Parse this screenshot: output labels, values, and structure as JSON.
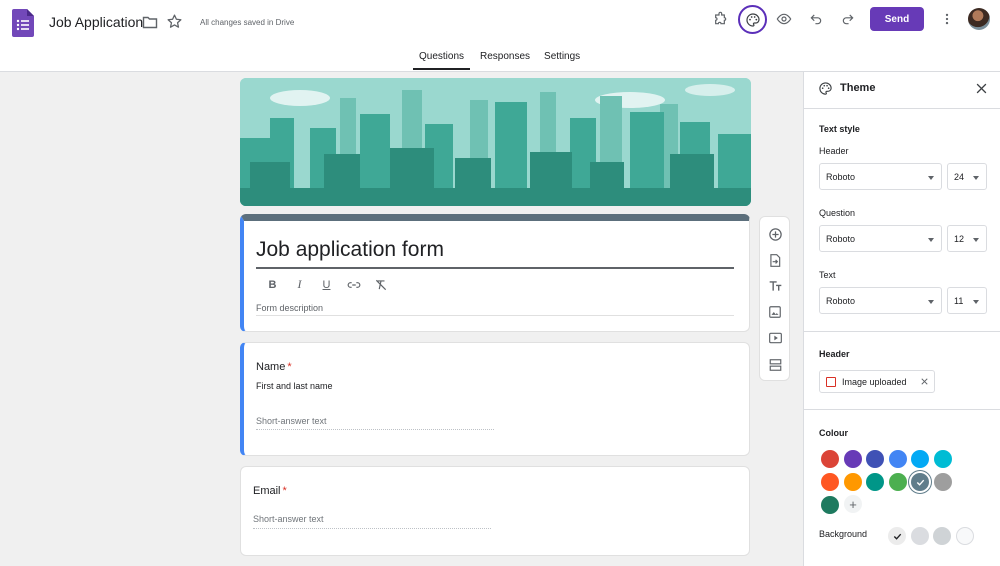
{
  "header": {
    "doc_title": "Job Application",
    "saved_status": "All changes saved in Drive",
    "send_label": "Send",
    "icons": [
      "forms-logo-icon",
      "folder-icon",
      "star-icon",
      "addons-icon",
      "palette-icon",
      "preview-icon",
      "undo-icon",
      "redo-icon",
      "more-icon"
    ]
  },
  "tabs": [
    {
      "label": "Questions",
      "active": true
    },
    {
      "label": "Responses",
      "active": false
    },
    {
      "label": "Settings",
      "active": false
    }
  ],
  "form": {
    "title": "Job application form",
    "description_placeholder": "Form description",
    "format_buttons": [
      "B",
      "I",
      "U"
    ]
  },
  "questions": [
    {
      "label": "Name",
      "required_mark": "*",
      "description": "First and last name",
      "placeholder": "Short-answer text"
    },
    {
      "label": "Email",
      "required_mark": "*",
      "placeholder": "Short-answer text"
    }
  ],
  "theme_panel": {
    "title": "Theme",
    "text_style_title": "Text style",
    "header_label": "Header",
    "header_font": "Roboto",
    "header_size": "24",
    "question_label": "Question",
    "question_font": "Roboto",
    "question_size": "12",
    "text_label": "Text",
    "text_font": "Roboto",
    "text_size": "11",
    "header_section_title": "Header",
    "image_chip_label": "Image uploaded",
    "colour_title": "Colour",
    "colours": [
      "#db4437",
      "#673ab7",
      "#3f51b5",
      "#4285f4",
      "#03a9f4",
      "#00bcd4",
      "#ff5722",
      "#ff9800",
      "#009688",
      "#4caf50",
      "#607d8b",
      "#9e9e9e",
      "#1e7a5f"
    ],
    "selected_colour": "#607d8b",
    "add_colour": "+",
    "background_label": "Background",
    "backgrounds": [
      "#ececec",
      "#dadce0",
      "#cfd3d6",
      "#f8f9fa"
    ],
    "selected_background": "#ececec"
  }
}
